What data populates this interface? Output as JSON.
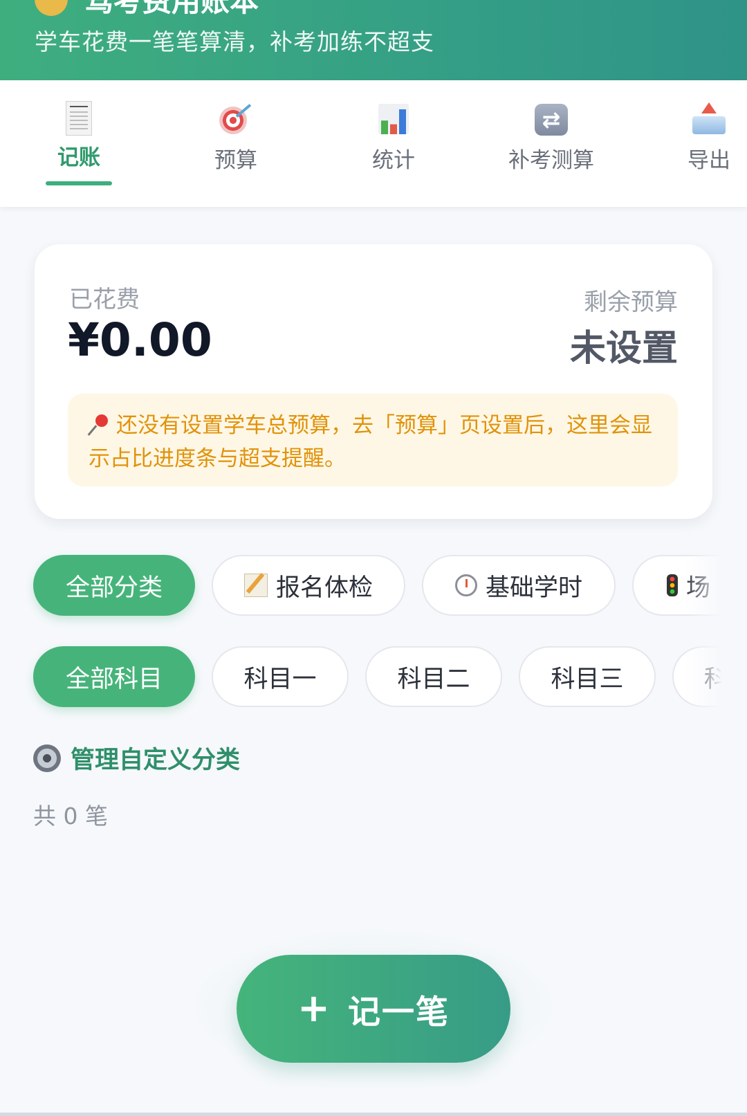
{
  "header": {
    "title": "驾考费用账本",
    "subtitle": "学车花费一笔笔算清，补考加练不超支"
  },
  "tabs": [
    {
      "label": "记账",
      "icon": "receipt-icon",
      "active": true
    },
    {
      "label": "预算",
      "icon": "target-icon",
      "active": false
    },
    {
      "label": "统计",
      "icon": "bar-chart-icon",
      "active": false
    },
    {
      "label": "补考测算",
      "icon": "repeat-icon",
      "active": false
    },
    {
      "label": "导出",
      "icon": "export-icon",
      "active": false
    }
  ],
  "summary": {
    "spent_label": "已花费",
    "spent_value": "¥0.00",
    "remaining_label": "剩余预算",
    "remaining_value": "未设置",
    "notice": "还没有设置学车总预算，去「预算」页设置后，这里会显示占比进度条与超支提醒。"
  },
  "category_chips": [
    "全部分类",
    "报名体检",
    "基础学时",
    "场"
  ],
  "subject_chips": [
    "全部科目",
    "科目一",
    "科目二",
    "科目三",
    "科"
  ],
  "manage_label": "管理自定义分类",
  "record_count": "共 0 笔",
  "fab": {
    "plus": "+",
    "label": "记一笔"
  },
  "colors": {
    "primary": "#46b47a",
    "header": "#35a085",
    "notice_text": "#e0930a",
    "notice_bg": "#fff7e6"
  }
}
